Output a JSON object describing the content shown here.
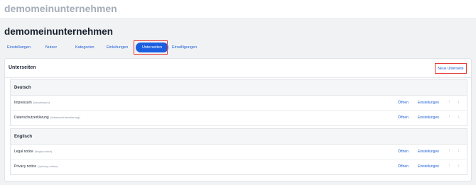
{
  "topbar": {
    "brand": "demomeinunternehmen"
  },
  "page": {
    "title": "demomeinunternehmen"
  },
  "tabs": [
    {
      "label": "Einstellungen"
    },
    {
      "label": "Nutzer"
    },
    {
      "label": "Kategorien"
    },
    {
      "label": "Einleitungen"
    },
    {
      "label": "Unterseiten",
      "active": true
    },
    {
      "label": "Einwilligungen"
    }
  ],
  "card": {
    "title": "Unterseiten",
    "new_button": "Neue Unterseite",
    "groups": [
      {
        "heading": "Deutsch",
        "rows": [
          {
            "name": "Impressum",
            "slug": "(/impressum)"
          },
          {
            "name": "Datenschutzerklärung",
            "slug": "(/datenschutzerklarung)"
          }
        ]
      },
      {
        "heading": "Englisch",
        "rows": [
          {
            "name": "Legal notice",
            "slug": "(/legal-notice)"
          },
          {
            "name": "Privacy notice",
            "slug": "(/privacy-notice)"
          }
        ]
      }
    ],
    "row_actions": {
      "open": "Öffnen",
      "settings": "Einstellungen",
      "up_icon": "↑",
      "down_icon": "↓"
    }
  },
  "colors": {
    "accent": "#1b5fe0",
    "highlight": "#e53935",
    "link": "#1f5fd6"
  }
}
